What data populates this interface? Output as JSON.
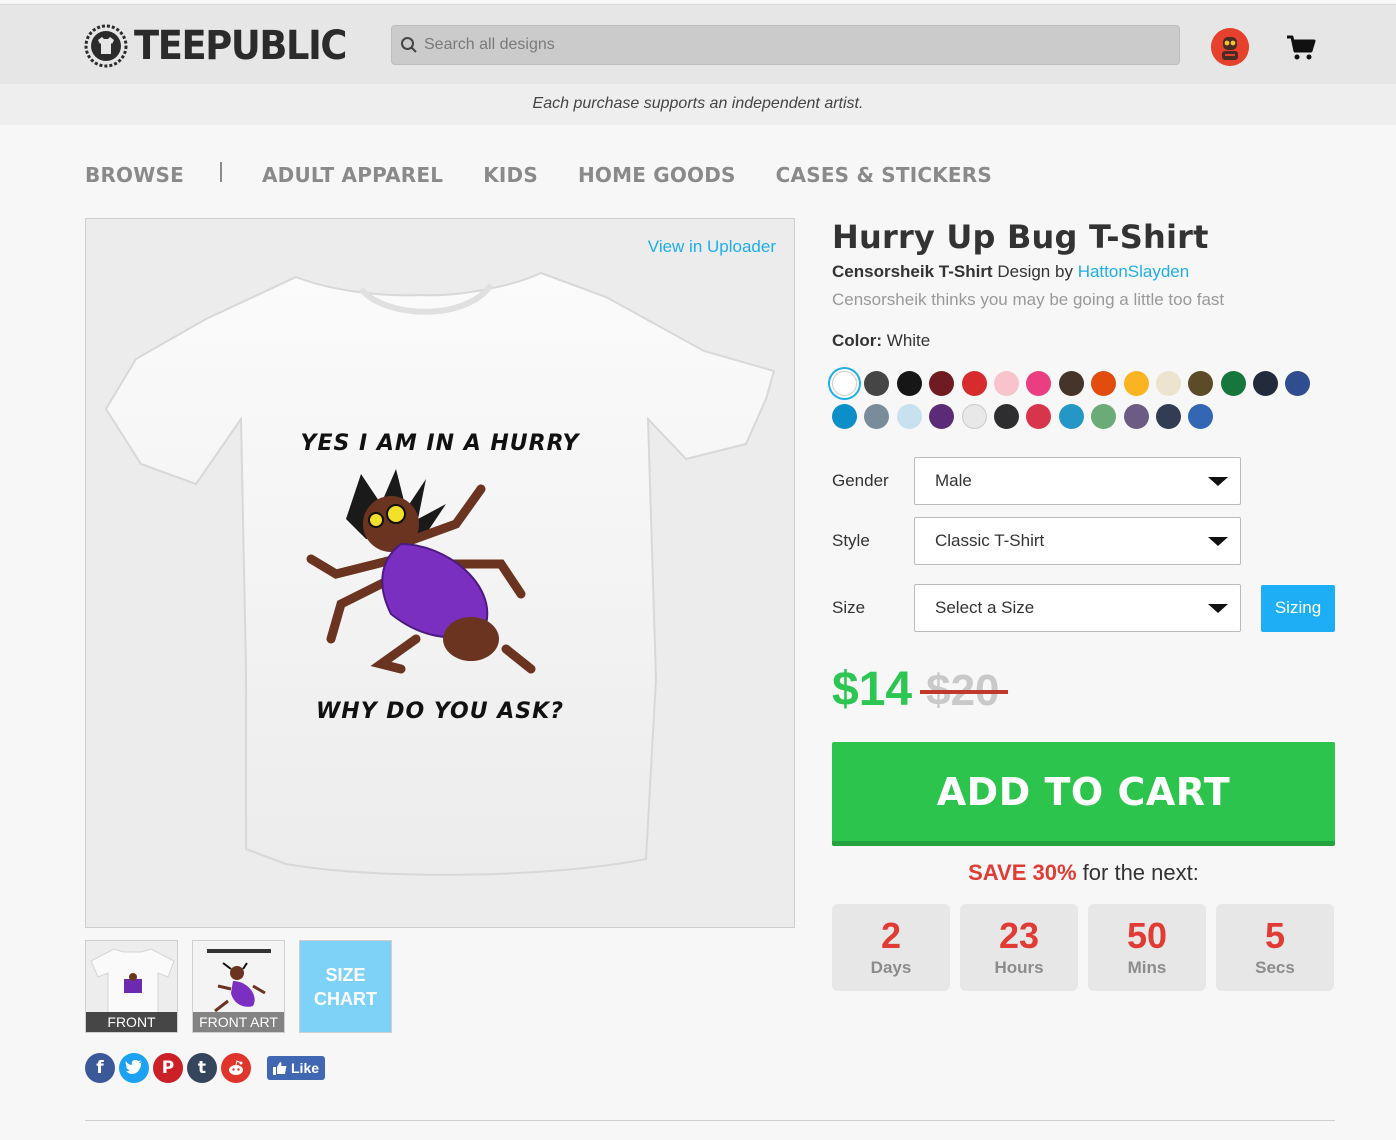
{
  "header": {
    "logo_text": "TEEPUBLIC",
    "search_placeholder": "Search all designs"
  },
  "notice": "Each purchase supports an independent artist.",
  "nav": {
    "browse": "BROWSE",
    "items": [
      "ADULT APPAREL",
      "KIDS",
      "HOME GOODS",
      "CASES & STICKERS"
    ]
  },
  "gallery": {
    "view_uploader": "View in Uploader",
    "shirt_text_top": "YES I AM IN A HURRY",
    "shirt_text_bottom": "WHY DO YOU ASK?",
    "thumbs": [
      "FRONT",
      "FRONT ART"
    ],
    "size_chart_line1": "SIZE",
    "size_chart_line2": "CHART"
  },
  "social": {
    "icons": [
      "facebook-icon",
      "twitter-icon",
      "pinterest-icon",
      "tumblr-icon",
      "reddit-icon"
    ],
    "like_label": "Like"
  },
  "product": {
    "title": "Hurry Up Bug T-Shirt",
    "design_name": "Censorsheik T-Shirt",
    "design_by": "Design by",
    "artist": "HattonSlayden",
    "description": "Censorsheik thinks you may be going a little too fast",
    "color_label": "Color:",
    "color_value": "White",
    "swatches": [
      "#ffffff",
      "#454545",
      "#161616",
      "#6f1b22",
      "#d72b2e",
      "#f9c3cd",
      "#eb3e80",
      "#45342a",
      "#e24c0f",
      "#fab421",
      "#ece4ce",
      "#5b4b26",
      "#16763c",
      "#222b3c",
      "#2f4d8f",
      "#0c8fc8",
      "#7a8c99",
      "#c8e1ef",
      "#5c2b78",
      "#e8e8e8",
      "#2e2e30",
      "#d7354c",
      "#2497c6",
      "#6aab77",
      "#6c5b85",
      "#323c52",
      "#3367b3"
    ],
    "gender_label": "Gender",
    "gender_value": "Male",
    "style_label": "Style",
    "style_value": "Classic T-Shirt",
    "size_label": "Size",
    "size_value": "Select a Size",
    "sizing_button": "Sizing",
    "price_now": "$14",
    "price_old": "$20",
    "add_to_cart": "ADD TO CART",
    "save_strong": "SAVE 30%",
    "save_rest": "for the next:",
    "timer": [
      {
        "num": "2",
        "unit": "Days"
      },
      {
        "num": "23",
        "unit": "Hours"
      },
      {
        "num": "50",
        "unit": "Mins"
      },
      {
        "num": "5",
        "unit": "Secs"
      }
    ]
  }
}
